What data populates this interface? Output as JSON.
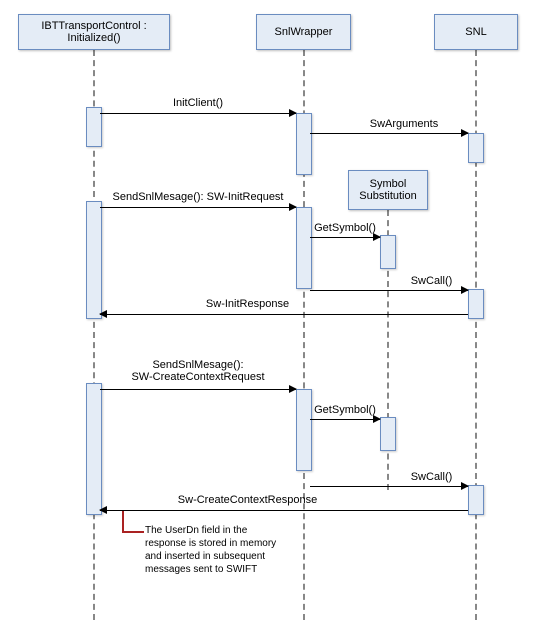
{
  "participants": {
    "p1": "IBTTransportControl : Initialized()",
    "p2": "SnlWrapper",
    "p3": "SNL"
  },
  "messages": {
    "m1": "InitClient()",
    "m2": "SwArguments",
    "m3": "SendSnlMesage(): SW-InitRequest",
    "m4": "GetSymbol()",
    "m5": "SwCall()",
    "m6": "Sw-InitResponse",
    "m7": "SendSnlMesage():\nSW-CreateContextRequest",
    "m8": "GetSymbol()",
    "m9": "SwCall()",
    "m10": "Sw-CreateContextResponse"
  },
  "notes": {
    "symbol_sub": "Symbol\nSubstitution",
    "userdn": "The UserDn field in the\nresponse is stored in\nmemory and inserted\nin subsequent messages\nsent to SWIFT"
  },
  "chart_data": {
    "type": "diagram",
    "diagram_type": "UML Sequence Diagram",
    "participants": [
      "IBTTransportControl : Initialized()",
      "SnlWrapper",
      "SNL"
    ],
    "fragments": [
      {
        "type": "note",
        "text": "Symbol Substitution",
        "attached_to": "SnlWrapper"
      }
    ],
    "messages": [
      {
        "from": "IBTTransportControl",
        "to": "SnlWrapper",
        "label": "InitClient()",
        "direction": "call"
      },
      {
        "from": "SnlWrapper",
        "to": "SNL",
        "label": "SwArguments",
        "direction": "call"
      },
      {
        "from": "IBTTransportControl",
        "to": "SnlWrapper",
        "label": "SendSnlMesage(): SW-InitRequest",
        "direction": "call"
      },
      {
        "from": "SnlWrapper",
        "to": "SymbolSubstitution",
        "label": "GetSymbol()",
        "direction": "call"
      },
      {
        "from": "SnlWrapper",
        "to": "SNL",
        "label": "SwCall()",
        "direction": "call"
      },
      {
        "from": "SNL",
        "to": "IBTTransportControl",
        "label": "Sw-InitResponse",
        "direction": "return"
      },
      {
        "from": "IBTTransportControl",
        "to": "SnlWrapper",
        "label": "SendSnlMesage(): SW-CreateContextRequest",
        "direction": "call"
      },
      {
        "from": "SnlWrapper",
        "to": "SymbolSubstitution",
        "label": "GetSymbol()",
        "direction": "call"
      },
      {
        "from": "SnlWrapper",
        "to": "SNL",
        "label": "SwCall()",
        "direction": "call"
      },
      {
        "from": "SNL",
        "to": "IBTTransportControl",
        "label": "Sw-CreateContextResponse",
        "direction": "return"
      }
    ],
    "annotations": [
      {
        "on": "Sw-CreateContextResponse",
        "text": "The UserDn field in the response is stored in memory and inserted in subsequent messages sent to SWIFT"
      }
    ]
  }
}
